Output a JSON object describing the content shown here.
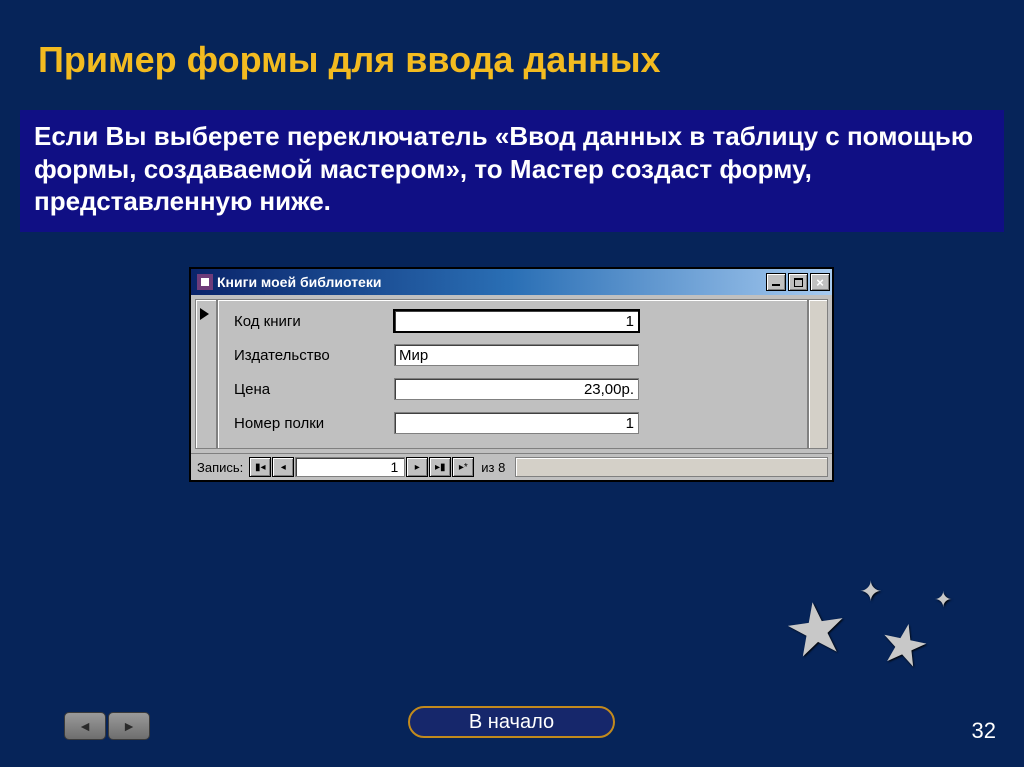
{
  "slide": {
    "title": "Пример формы для ввода данных",
    "description": "Если Вы выберете переключатель «Ввод данных в таблицу с помощью формы, создаваемой мастером», то Мастер создаст форму, представленную ниже.",
    "footer_button": "В начало",
    "page_number": "32"
  },
  "window": {
    "title": "Книги моей библиотеки",
    "fields": [
      {
        "label": "Код книги",
        "value": "1",
        "align": "right",
        "focused": true
      },
      {
        "label": "Издательство",
        "value": "Мир",
        "align": "left",
        "focused": false
      },
      {
        "label": "Цена",
        "value": "23,00р.",
        "align": "right",
        "focused": false
      },
      {
        "label": "Номер полки",
        "value": "1",
        "align": "right",
        "focused": false
      }
    ],
    "nav": {
      "label": "Запись:",
      "current": "1",
      "count_prefix": "из",
      "count": "8"
    }
  }
}
